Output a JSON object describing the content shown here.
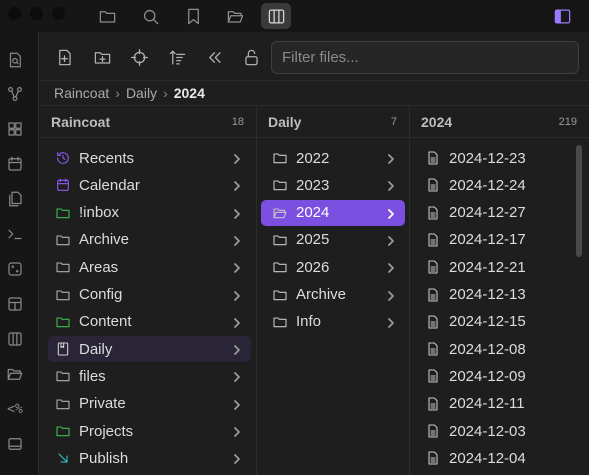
{
  "colors": {
    "accent": "#7b4fe0",
    "folder_green": "#3fbf4f",
    "recents_purple": "#8b5cf6",
    "publish_cyan": "#36c5c9"
  },
  "filter": {
    "placeholder": "Filter files..."
  },
  "breadcrumb": {
    "items": [
      "Raincoat",
      "Daily"
    ],
    "current": "2024"
  },
  "columns": [
    {
      "title": "Raincoat",
      "count": "18",
      "items": [
        {
          "label": "Recents",
          "icon": "history-icon",
          "color": "#8b5cf6"
        },
        {
          "label": "Calendar",
          "icon": "calendar-icon",
          "color": "#8b5cf6"
        },
        {
          "label": "!inbox",
          "icon": "folder-icon",
          "color": "#3fbf4f"
        },
        {
          "label": "Archive",
          "icon": "folder-icon",
          "color": "#b0b0b0"
        },
        {
          "label": "Areas",
          "icon": "folder-icon",
          "color": "#b0b0b0"
        },
        {
          "label": "Config",
          "icon": "folder-icon",
          "color": "#b0b0b0"
        },
        {
          "label": "Content",
          "icon": "folder-icon",
          "color": "#3fbf4f"
        },
        {
          "label": "Daily",
          "icon": "journal-icon",
          "color": "#d0d0d0"
        },
        {
          "label": "files",
          "icon": "folder-icon",
          "color": "#b0b0b0"
        },
        {
          "label": "Private",
          "icon": "folder-icon",
          "color": "#b0b0b0"
        },
        {
          "label": "Projects",
          "icon": "folder-icon",
          "color": "#3fbf4f"
        },
        {
          "label": "Publish",
          "icon": "arrow-down-right-icon",
          "color": "#36c5c9"
        }
      ]
    },
    {
      "title": "Daily",
      "count": "7",
      "items": [
        {
          "label": "2022",
          "icon": "folder-icon"
        },
        {
          "label": "2023",
          "icon": "folder-icon"
        },
        {
          "label": "2024",
          "icon": "folder-open-icon"
        },
        {
          "label": "2025",
          "icon": "folder-icon"
        },
        {
          "label": "2026",
          "icon": "folder-icon"
        },
        {
          "label": "Archive",
          "icon": "folder-icon"
        },
        {
          "label": "Info",
          "icon": "folder-icon"
        }
      ]
    },
    {
      "title": "2024",
      "count": "219",
      "items": [
        {
          "label": "2024-12-23"
        },
        {
          "label": "2024-12-24"
        },
        {
          "label": "2024-12-27"
        },
        {
          "label": "2024-12-17"
        },
        {
          "label": "2024-12-21"
        },
        {
          "label": "2024-12-13"
        },
        {
          "label": "2024-12-15"
        },
        {
          "label": "2024-12-08"
        },
        {
          "label": "2024-12-09"
        },
        {
          "label": "2024-12-11"
        },
        {
          "label": "2024-12-03"
        },
        {
          "label": "2024-12-04"
        }
      ]
    }
  ],
  "ribbon": {
    "snippet_label": "<%"
  }
}
